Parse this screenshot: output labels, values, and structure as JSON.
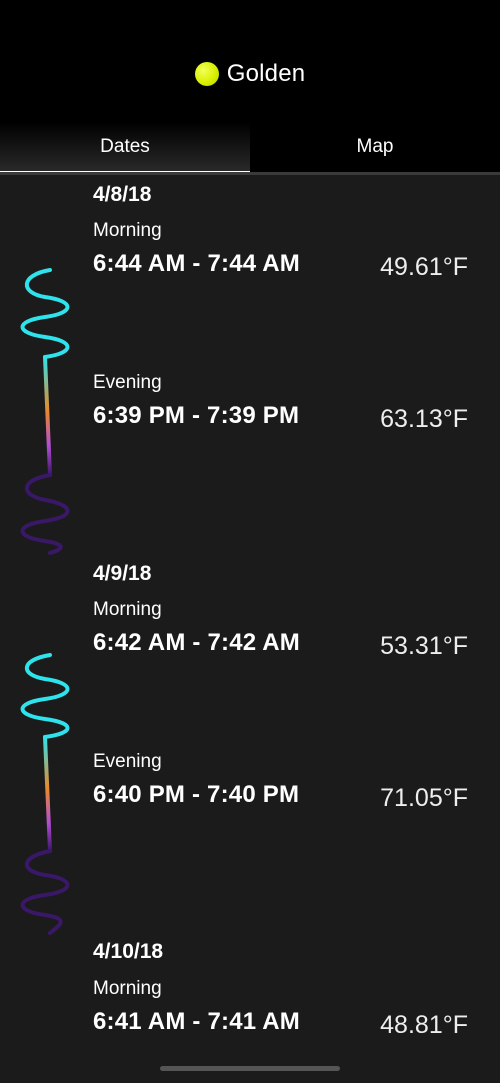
{
  "header": {
    "title": "Golden",
    "status_color": "#d8f000"
  },
  "tabs": [
    {
      "label": "Dates",
      "active": true
    },
    {
      "label": "Map",
      "active": false
    }
  ],
  "days": [
    {
      "date": "4/8/18",
      "morning": {
        "label": "Morning",
        "time": "6:44 AM - 7:44 AM",
        "temp": "49.61°F"
      },
      "evening": {
        "label": "Evening",
        "time": "6:39 PM - 7:39 PM",
        "temp": "63.13°F"
      }
    },
    {
      "date": "4/9/18",
      "morning": {
        "label": "Morning",
        "time": "6:42 AM - 7:42 AM",
        "temp": "53.31°F"
      },
      "evening": {
        "label": "Evening",
        "time": "6:40 PM - 7:40 PM",
        "temp": "71.05°F"
      }
    },
    {
      "date": "4/10/18",
      "morning": {
        "label": "Morning",
        "time": "6:41 AM - 7:41 AM",
        "temp": "48.81°F"
      }
    }
  ],
  "colors": {
    "sunrise_red": "#c43a1c",
    "golden_orange": "#e88a2a",
    "day_cyan": "#2fe3ec",
    "dusk_magenta": "#b44dd4",
    "night_purple": "#3a1868"
  }
}
